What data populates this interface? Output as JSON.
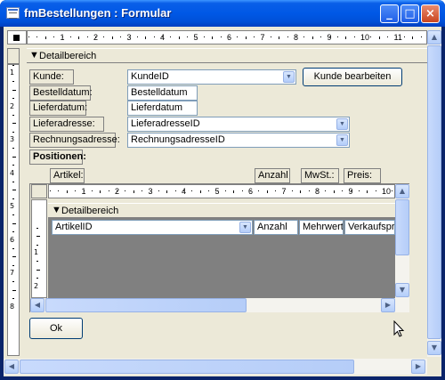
{
  "window": {
    "title": "fmBestellungen : Formular",
    "controls": {
      "minimize": "_",
      "maximize": "□",
      "close": "×"
    }
  },
  "ruler_numbers": [
    "1",
    "2",
    "3",
    "4",
    "5",
    "6",
    "7",
    "8",
    "9",
    "10",
    "11",
    "12"
  ],
  "vruler_numbers": [
    "1",
    "2",
    "3",
    "4",
    "5",
    "6",
    "7",
    "8"
  ],
  "detail_section": {
    "label": "Detailbereich"
  },
  "fields": {
    "kunde_label": "Kunde:",
    "kunde_value": "KundeID",
    "kunde_button": "Kunde bearbeiten",
    "bestelldatum_label": "Bestelldatum:",
    "bestelldatum_value": "Bestelldatum",
    "lieferdatum_label": "Lieferdatum:",
    "lieferdatum_value": "Lieferdatum",
    "lieferadresse_label": "Lieferadresse:",
    "lieferadresse_value": "LieferadresseID",
    "rechnungsadresse_label": "Rechnungsadresse:",
    "rechnungsadresse_value": "RechnungsadresseID",
    "positionen_label": "Positionen:"
  },
  "subform": {
    "header_labels": {
      "artikel": "Artikel:",
      "anzahl": "Anzahl",
      "mwst": "MwSt.:",
      "preis": "Preis:"
    },
    "ruler_numbers": [
      "1",
      "2",
      "3",
      "4",
      "5",
      "6",
      "7",
      "8",
      "9",
      "10"
    ],
    "vruler_numbers": [
      "1",
      "2"
    ],
    "detail_label": "Detailbereich",
    "row": {
      "artikel": "ArtikelID",
      "anzahl": "Anzahl",
      "mwst": "Mehrwert",
      "preis": "Verkaufspre"
    }
  },
  "ok_button": "Ok",
  "icons": [
    "form-icon",
    "minimize-icon",
    "maximize-icon",
    "close-icon",
    "dropdown-arrow-icon",
    "scroll-arrow-icon",
    "mouse-cursor-icon",
    "section-arrow-icon"
  ]
}
